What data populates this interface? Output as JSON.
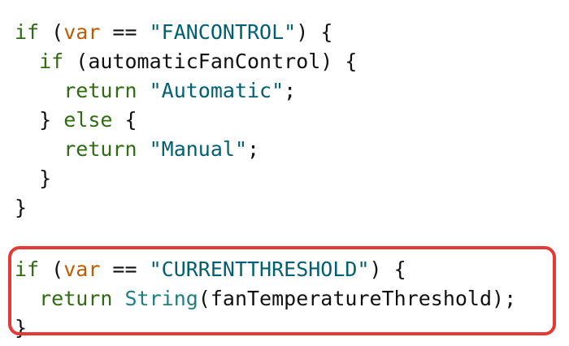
{
  "code": {
    "lines": [
      {
        "indent": "",
        "tokens": [
          {
            "t": "if",
            "c": "kw"
          },
          {
            "t": " (",
            "c": "plain"
          },
          {
            "t": "var",
            "c": "var"
          },
          {
            "t": " == ",
            "c": "plain"
          },
          {
            "t": "\"FANCONTROL\"",
            "c": "str"
          },
          {
            "t": ") {",
            "c": "plain"
          }
        ]
      },
      {
        "indent": "  ",
        "tokens": [
          {
            "t": "if",
            "c": "kw"
          },
          {
            "t": " (automaticFanControl) {",
            "c": "plain"
          }
        ]
      },
      {
        "indent": "    ",
        "tokens": [
          {
            "t": "return",
            "c": "kw"
          },
          {
            "t": " ",
            "c": "plain"
          },
          {
            "t": "\"Automatic\"",
            "c": "str"
          },
          {
            "t": ";",
            "c": "plain"
          }
        ]
      },
      {
        "indent": "  ",
        "tokens": [
          {
            "t": "} ",
            "c": "plain"
          },
          {
            "t": "else",
            "c": "kw"
          },
          {
            "t": " {",
            "c": "plain"
          }
        ]
      },
      {
        "indent": "    ",
        "tokens": [
          {
            "t": "return",
            "c": "kw"
          },
          {
            "t": " ",
            "c": "plain"
          },
          {
            "t": "\"Manual\"",
            "c": "str"
          },
          {
            "t": ";",
            "c": "plain"
          }
        ]
      },
      {
        "indent": "  ",
        "tokens": [
          {
            "t": "}",
            "c": "plain"
          }
        ]
      },
      {
        "indent": "",
        "tokens": [
          {
            "t": "}",
            "c": "plain"
          }
        ]
      },
      {
        "gap": true
      },
      {
        "indent": "",
        "tokens": [
          {
            "t": "if",
            "c": "kw"
          },
          {
            "t": " (",
            "c": "plain"
          },
          {
            "t": "var",
            "c": "var"
          },
          {
            "t": " == ",
            "c": "plain"
          },
          {
            "t": "\"CURRENTTHRESHOLD\"",
            "c": "str"
          },
          {
            "t": ") {",
            "c": "plain"
          }
        ]
      },
      {
        "indent": "  ",
        "tokens": [
          {
            "t": "return",
            "c": "kw"
          },
          {
            "t": " ",
            "c": "plain"
          },
          {
            "t": "String",
            "c": "type"
          },
          {
            "t": "(fanTemperatureThreshold);",
            "c": "plain"
          }
        ]
      },
      {
        "indent": "",
        "tokens": [
          {
            "t": "}",
            "c": "plain"
          }
        ]
      }
    ]
  },
  "colors": {
    "keyword": "#2f6b12",
    "var": "#c05a00",
    "string": "#005f73",
    "type": "#1f7f7f",
    "highlight_border": "#e53935",
    "background": "#ffffff"
  }
}
